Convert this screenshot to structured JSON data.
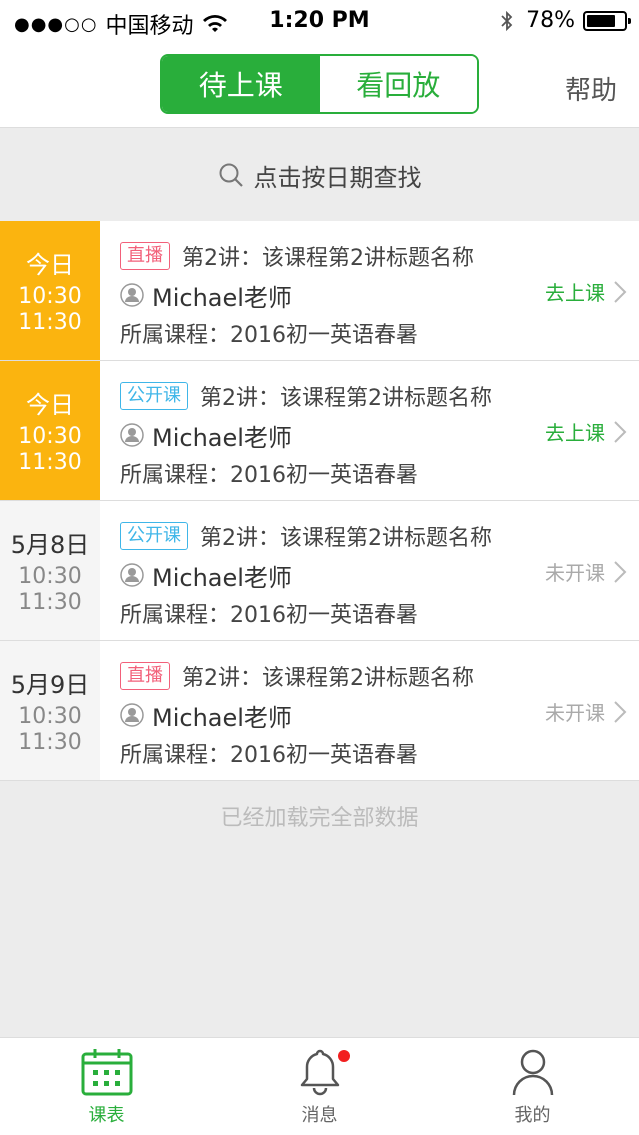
{
  "status": {
    "signal": "●●●○○",
    "carrier": "中国移动",
    "time": "1:20 PM",
    "battery": "78%",
    "battery_level": 0.78
  },
  "header": {
    "tabs": [
      {
        "label": "待上课",
        "active": true
      },
      {
        "label": "看回放",
        "active": false
      }
    ],
    "help": "帮助"
  },
  "search": {
    "placeholder": "点击按日期查找"
  },
  "lessons": [
    {
      "day": "今日",
      "start": "10:30",
      "end": "11:30",
      "tag": "直播",
      "tag_type": "live",
      "title": "第2讲：该课程第2讲标题名称",
      "teacher": "Michael老师",
      "course": "所属课程：2016初一英语春暑",
      "action": "去上课",
      "action_type": "go"
    },
    {
      "day": "今日",
      "start": "10:30",
      "end": "11:30",
      "tag": "公开课",
      "tag_type": "open",
      "title": "第2讲：该课程第2讲标题名称",
      "teacher": "Michael老师",
      "course": "所属课程：2016初一英语春暑",
      "action": "去上课",
      "action_type": "go"
    },
    {
      "day": "5月8日",
      "start": "10:30",
      "end": "11:30",
      "tag": "公开课",
      "tag_type": "open",
      "title": "第2讲：该课程第2讲标题名称",
      "teacher": "Michael老师",
      "course": "所属课程：2016初一英语春暑",
      "action": "未开课",
      "action_type": "wait"
    },
    {
      "day": "5月9日",
      "start": "10:30",
      "end": "11:30",
      "tag": "直播",
      "tag_type": "live",
      "title": "第2讲：该课程第2讲标题名称",
      "teacher": "Michael老师",
      "course": "所属课程：2016初一英语春暑",
      "action": "未开课",
      "action_type": "wait"
    }
  ],
  "footer_text": "已经加载完全部数据",
  "tabbar": {
    "items": [
      {
        "label": "课表",
        "icon": "calendar-icon",
        "active": true
      },
      {
        "label": "消息",
        "icon": "bell-icon",
        "active": false,
        "badge": true
      },
      {
        "label": "我的",
        "icon": "person-icon",
        "active": false
      }
    ]
  },
  "colors": {
    "accent": "#29ae3b",
    "today": "#fbb40f",
    "live": "#f2607a",
    "open": "#3fb6e8"
  }
}
